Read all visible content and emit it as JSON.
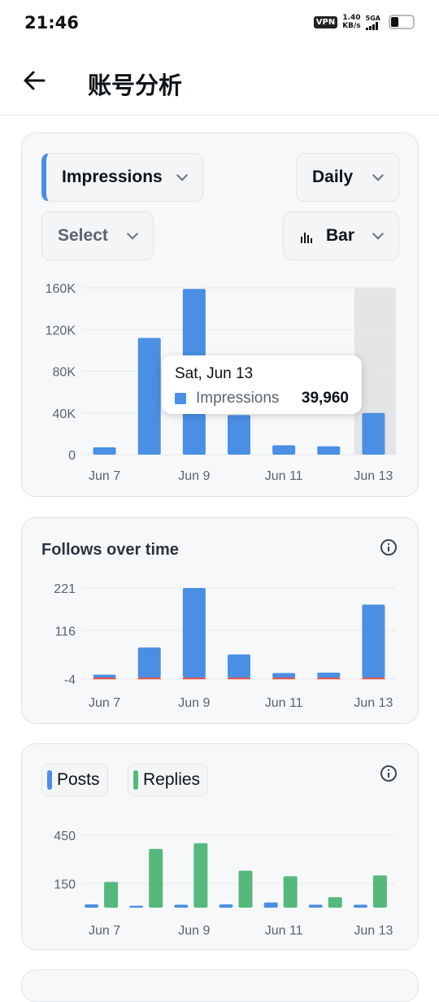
{
  "status_bar": {
    "time": "21:46",
    "vpn": "VPN",
    "speed_value": "1.40",
    "speed_unit": "KB/s",
    "network": "5GA"
  },
  "header": {
    "title": "账号分析",
    "back_icon": "arrow-left-icon"
  },
  "impressions_card": {
    "metric_label": "Impressions",
    "period_label": "Daily",
    "compare_label": "Select",
    "chart_type_label": "Bar",
    "chart_type_icon": "bar-chart-icon",
    "tooltip": {
      "date": "Sat, Jun 13",
      "series": "Impressions",
      "value": "39,960"
    }
  },
  "follows_card": {
    "title": "Follows over time",
    "info_icon": "info-icon"
  },
  "posts_card": {
    "legend_posts": "Posts",
    "legend_replies": "Replies",
    "info_icon": "info-icon"
  },
  "colors": {
    "blue": "#4a8fe3",
    "green": "#55b97d",
    "red": "#e0564f",
    "highlight": "#e3e4e6"
  },
  "chart_data": [
    {
      "type": "bar",
      "name": "impressions",
      "categories": [
        "Jun 7",
        "Jun 8",
        "Jun 9",
        "Jun 10",
        "Jun 11",
        "Jun 12",
        "Jun 13"
      ],
      "x_tick_labels": [
        "Jun 7",
        "Jun 9",
        "Jun 11",
        "Jun 13"
      ],
      "y_tick_labels": [
        "0",
        "40K",
        "80K",
        "120K",
        "160K"
      ],
      "y_ticks": [
        0,
        40000,
        80000,
        120000,
        160000
      ],
      "ylim": [
        0,
        160000
      ],
      "series": [
        {
          "values": [
            7000,
            112000,
            159000,
            38000,
            9000,
            8000,
            39960
          ]
        }
      ],
      "highlight_category": "Jun 13",
      "grid": true
    },
    {
      "type": "bar",
      "name": "follows",
      "categories": [
        "Jun 7",
        "Jun 8",
        "Jun 9",
        "Jun 10",
        "Jun 11",
        "Jun 12",
        "Jun 13"
      ],
      "x_tick_labels": [
        "Jun 7",
        "Jun 9",
        "Jun 11",
        "Jun 13"
      ],
      "y_tick_labels": [
        "-4",
        "116",
        "221"
      ],
      "y_ticks": [
        -4,
        116,
        221
      ],
      "ylim": [
        -4,
        221
      ],
      "series": [
        {
          "color_key": "blue",
          "values": [
            7,
            74,
            221,
            57,
            11,
            12,
            180
          ]
        },
        {
          "color_key": "red",
          "values": [
            -1,
            0,
            -2,
            -1,
            -2,
            0,
            -3
          ]
        }
      ],
      "grid": true
    },
    {
      "type": "bar",
      "name": "posts_replies",
      "categories": [
        "Jun 7",
        "Jun 8",
        "Jun 9",
        "Jun 10",
        "Jun 11",
        "Jun 12",
        "Jun 13"
      ],
      "x_tick_labels": [
        "Jun 7",
        "Jun 9",
        "Jun 11",
        "Jun 13"
      ],
      "y_tick_labels": [
        "150",
        "450"
      ],
      "y_ticks": [
        150,
        450
      ],
      "ylim": [
        0,
        500
      ],
      "series": [
        {
          "name": "Posts",
          "color_key": "blue",
          "values": [
            20,
            12,
            18,
            20,
            32,
            18,
            18
          ]
        },
        {
          "name": "Replies",
          "color_key": "green",
          "values": [
            160,
            365,
            400,
            230,
            195,
            65,
            200
          ]
        }
      ],
      "grid": true
    }
  ]
}
